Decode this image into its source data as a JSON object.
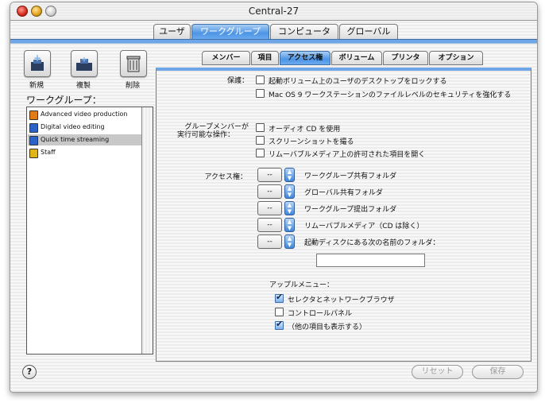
{
  "window": {
    "title": "Central-27"
  },
  "top_tabs": [
    {
      "label": "ユーザ"
    },
    {
      "label": "ワークグループ"
    },
    {
      "label": "コンピュータ"
    },
    {
      "label": "グローバル"
    }
  ],
  "toolbar": {
    "new_label": "新規",
    "duplicate_label": "複製",
    "delete_label": "削除"
  },
  "workgroups": {
    "heading": "ワークグループ：",
    "items": [
      {
        "label": "Advanced video production",
        "color": "#e07b16"
      },
      {
        "label": "Digital video editing",
        "color": "#2a62c8"
      },
      {
        "label": "Quick time streaming",
        "color": "#2a62c8"
      },
      {
        "label": "Staff",
        "color": "#e0b516"
      }
    ],
    "selected_index": 2
  },
  "sub_tabs": [
    {
      "label": "メンバー"
    },
    {
      "label": "項目"
    },
    {
      "label": "アクセス権"
    },
    {
      "label": "ボリューム"
    },
    {
      "label": "プリンタ"
    },
    {
      "label": "オプション"
    }
  ],
  "protection": {
    "label": "保護：",
    "options": [
      {
        "label": "起動ボリューム上のユーザのデスクトップをロックする",
        "checked": false
      },
      {
        "label": "Mac OS 9 ワークステーションのファイルレベルのセキュリティを強化する",
        "checked": false
      }
    ]
  },
  "member_ops": {
    "label_line1": "グループメンバーが",
    "label_line2": "実行可能な操作：",
    "options": [
      {
        "label": "オーディオ CD を使用",
        "checked": false
      },
      {
        "label": "スクリーンショットを撮る",
        "checked": false
      },
      {
        "label": "リムーバブルメディア上の許可された項目を開く",
        "checked": false
      }
    ]
  },
  "access": {
    "label": "アクセス権：",
    "rows": [
      {
        "value": "--",
        "label": "ワークグループ共有フォルダ"
      },
      {
        "value": "--",
        "label": "グローバル共有フォルダ"
      },
      {
        "value": "--",
        "label": "ワークグループ提出フォルダ"
      },
      {
        "value": "--",
        "label": "リムーバブルメディア（CD は除く）"
      },
      {
        "value": "--",
        "label": "起動ディスクにある次の名前のフォルダ："
      }
    ],
    "folder_name": ""
  },
  "apple_menu": {
    "label": "アップルメニュー：",
    "options": [
      {
        "label": "セレクタとネットワークブラウザ",
        "checked": true
      },
      {
        "label": "コントロールパネル",
        "checked": false
      },
      {
        "label": "（他の項目も表示する）",
        "checked": true
      }
    ]
  },
  "footer": {
    "help": "?",
    "revert_label": "リセット",
    "save_label": "保存"
  }
}
